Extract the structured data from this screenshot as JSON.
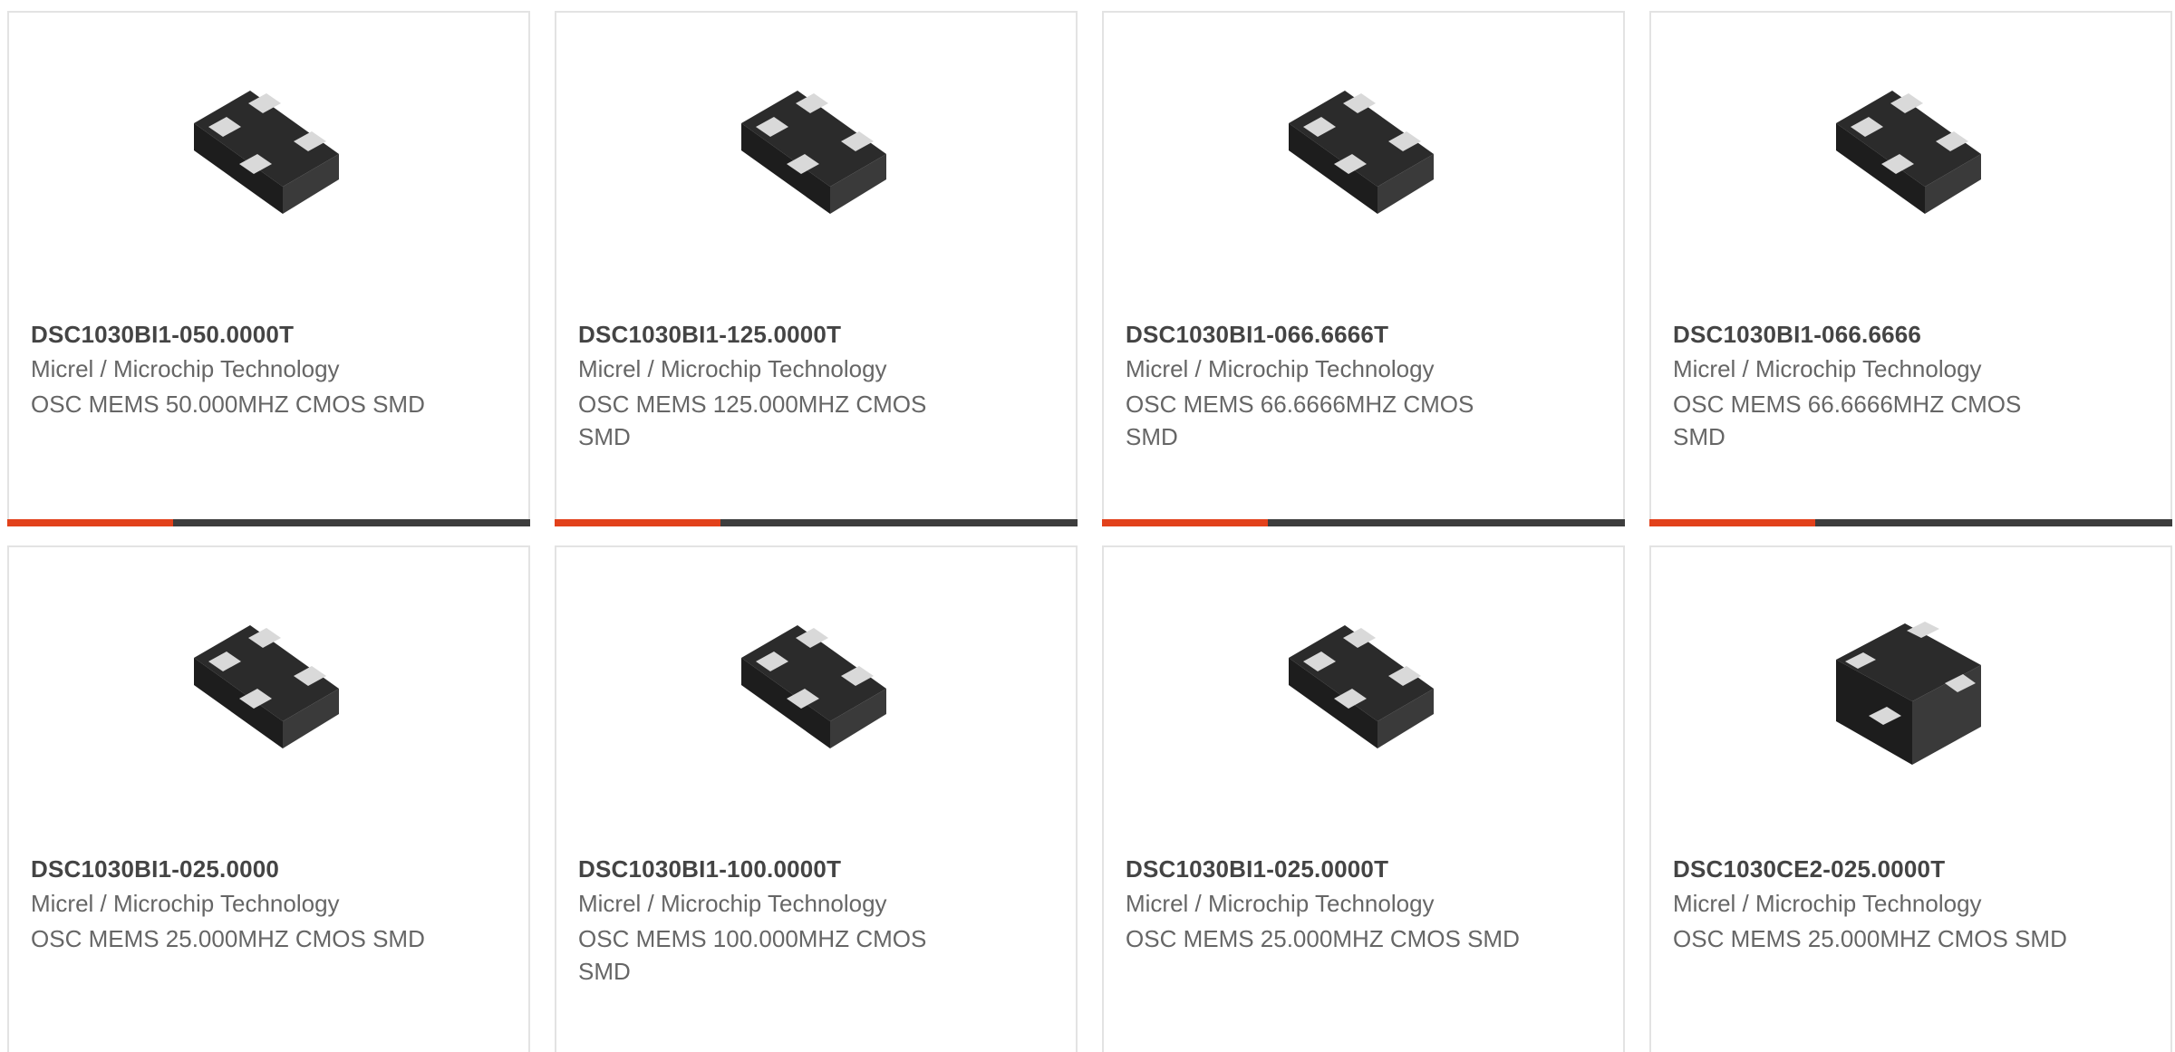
{
  "colors": {
    "accent": "#e2411b",
    "bar_dark": "#3d3d3d",
    "card_border": "#e3e3e3",
    "part_text": "#444444",
    "body_text": "#666666"
  },
  "products": [
    {
      "part_number": "DSC1030BI1-050.0000T",
      "manufacturer": "Micrel / Microchip Technology",
      "description": "OSC MEMS 50.000MHZ CMOS SMD",
      "image_icon": "mems-oscillator-chip-icon"
    },
    {
      "part_number": "DSC1030BI1-125.0000T",
      "manufacturer": "Micrel / Microchip Technology",
      "description": "OSC MEMS 125.000MHZ CMOS SMD",
      "image_icon": "mems-oscillator-chip-icon"
    },
    {
      "part_number": "DSC1030BI1-066.6666T",
      "manufacturer": "Micrel / Microchip Technology",
      "description": "OSC MEMS 66.6666MHZ CMOS SMD",
      "image_icon": "mems-oscillator-chip-icon"
    },
    {
      "part_number": "DSC1030BI1-066.6666",
      "manufacturer": "Micrel / Microchip Technology",
      "description": "OSC MEMS 66.6666MHZ CMOS SMD",
      "image_icon": "mems-oscillator-chip-icon"
    },
    {
      "part_number": "DSC1030BI1-025.0000",
      "manufacturer": "Micrel / Microchip Technology",
      "description": "OSC MEMS 25.000MHZ CMOS SMD",
      "image_icon": "mems-oscillator-chip-icon"
    },
    {
      "part_number": "DSC1030BI1-100.0000T",
      "manufacturer": "Micrel / Microchip Technology",
      "description": "OSC MEMS 100.000MHZ CMOS SMD",
      "image_icon": "mems-oscillator-chip-icon"
    },
    {
      "part_number": "DSC1030BI1-025.0000T",
      "manufacturer": "Micrel / Microchip Technology",
      "description": "OSC MEMS 25.000MHZ CMOS SMD",
      "image_icon": "mems-oscillator-chip-icon"
    },
    {
      "part_number": "DSC1030CE2-025.0000T",
      "manufacturer": "Micrel / Microchip Technology",
      "description": "OSC MEMS 25.000MHZ CMOS SMD",
      "image_icon": "mems-oscillator-chip-square-icon"
    }
  ]
}
